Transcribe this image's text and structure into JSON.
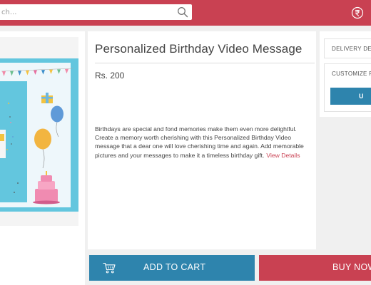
{
  "header": {
    "search_placeholder": "ch...",
    "search_icon": "search-icon",
    "currency_icon": "rupee-icon"
  },
  "product": {
    "title": "Personalized Birthday Video Message",
    "price": "Rs. 200",
    "description": "Birthdays are special and fond memories make them even more delightful. Create a memory worth cherishing with this Personalized Birthday Video message that a dear one will love cherishing time and again. Add memorable pictures and your messages to make it a timeless birthday gift.",
    "view_details": "View Details",
    "image": "birthday-illustration"
  },
  "side": {
    "delivery_label": "DELIVERY DE",
    "customize_label": "CUSTOMIZE P",
    "upload_label": "U"
  },
  "actions": {
    "add_to_cart": "ADD TO CART",
    "buy_now": "BUY NOW",
    "cart_icon": "cart-icon"
  },
  "colors": {
    "brand_red": "#c94152",
    "accent_blue": "#2e84ad"
  }
}
